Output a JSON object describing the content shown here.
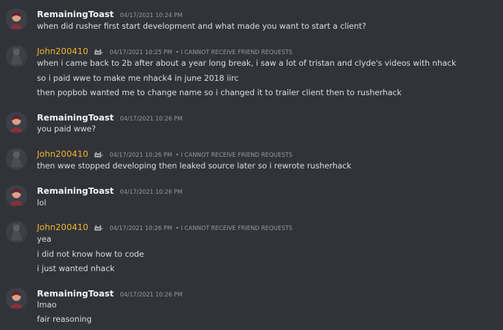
{
  "users": {
    "toast": {
      "name": "RemainingToast"
    },
    "john": {
      "name": "John200410",
      "note": "• I CANNOT RECEIVE FRIEND REQUESTS"
    }
  },
  "messages": [
    {
      "ts": "04/17/2021 10:24 PM",
      "lines": [
        "when did rusher first start development and what made you want to start a client?"
      ]
    },
    {
      "ts": "04/17/2021 10:25 PM",
      "lines": [
        "when i came back to 2b after about a year long break, i saw a lot of tristan and clyde's videos with nhack",
        "so i paid wwe to make me nhack4 in june 2018 iirc",
        "then popbob wanted me to change name so i changed it to trailer client then to rusherhack"
      ]
    },
    {
      "ts": "04/17/2021 10:26 PM",
      "lines": [
        "you paid wwe?"
      ]
    },
    {
      "ts": "04/17/2021 10:26 PM",
      "lines": [
        "then wwe stopped developing then leaked source later so i rewrote rusherhack"
      ]
    },
    {
      "ts": "04/17/2021 10:26 PM",
      "lines": [
        "lol"
      ]
    },
    {
      "ts": "04/17/2021 10:26 PM",
      "lines": [
        "yea",
        "i did not know how to code",
        "i just wanted nhack"
      ]
    },
    {
      "ts": "04/17/2021 10:26 PM",
      "lines": [
        "lmao",
        "fair reasoning"
      ]
    }
  ],
  "colors": {
    "background": "#313338",
    "john_name": "#f0b232",
    "timestamp": "#949ba4"
  }
}
